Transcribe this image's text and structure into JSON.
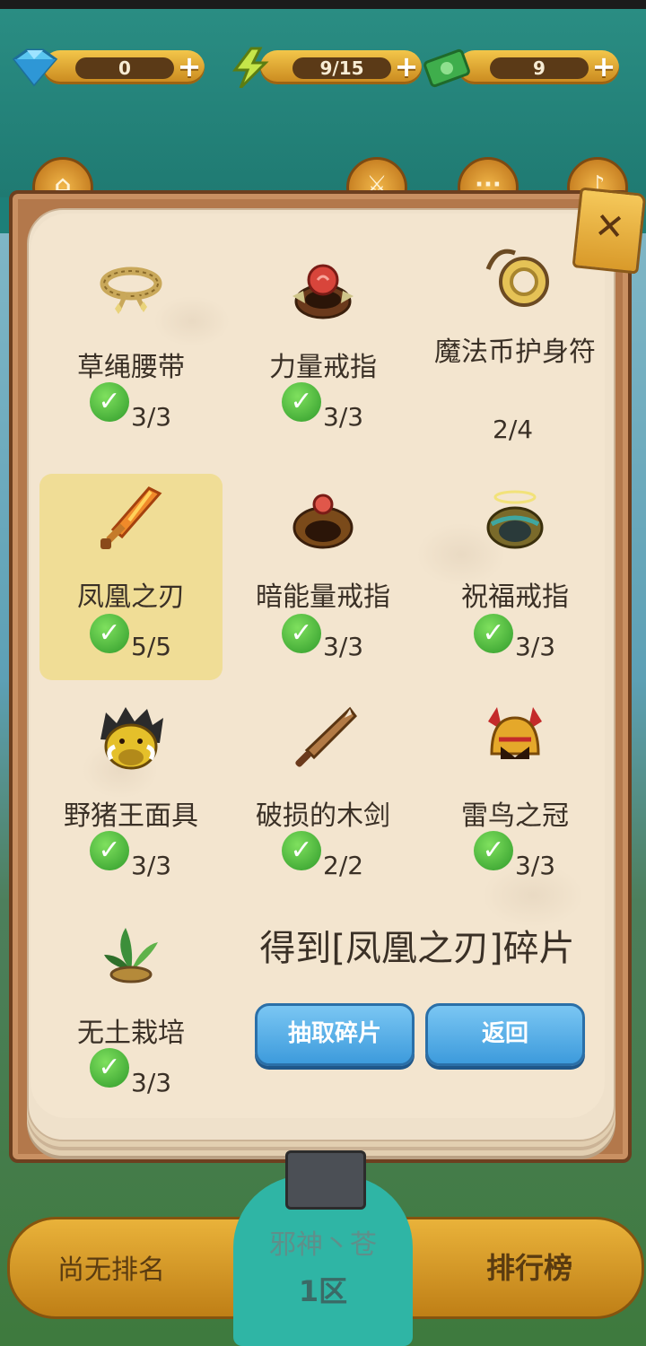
{
  "currencies": [
    {
      "icon": "diamond-icon",
      "value": "0"
    },
    {
      "icon": "energy-bolt-icon",
      "value": "9/15"
    },
    {
      "icon": "cash-icon",
      "value": "9"
    }
  ],
  "top_buttons": [
    "home-icon",
    "sword-icon",
    "more-icon",
    "sound-icon"
  ],
  "items": [
    {
      "name": "草绳腰带",
      "count": "3/3",
      "complete": true,
      "icon": "rope-belt-icon"
    },
    {
      "name": "力量戒指",
      "count": "3/3",
      "complete": true,
      "icon": "power-ring-icon"
    },
    {
      "name": "魔法币护身符",
      "count": "2/4",
      "complete": false,
      "icon": "magic-coin-amulet-icon"
    },
    {
      "name": "凤凰之刃",
      "count": "5/5",
      "complete": true,
      "icon": "phoenix-blade-icon",
      "selected": true
    },
    {
      "name": "暗能量戒指",
      "count": "3/3",
      "complete": true,
      "icon": "dark-energy-ring-icon"
    },
    {
      "name": "祝福戒指",
      "count": "3/3",
      "complete": true,
      "icon": "blessing-ring-icon"
    },
    {
      "name": "野猪王面具",
      "count": "3/3",
      "complete": true,
      "icon": "boar-king-mask-icon"
    },
    {
      "name": "破损的木剑",
      "count": "2/2",
      "complete": true,
      "icon": "broken-wooden-sword-icon"
    },
    {
      "name": "雷鸟之冠",
      "count": "3/3",
      "complete": true,
      "icon": "thunderbird-crown-icon"
    },
    {
      "name": "无土栽培",
      "count": "3/3",
      "complete": true,
      "icon": "soilless-plant-icon"
    }
  ],
  "obtain_text": "得到[凤凰之刃]碎片",
  "buttons": {
    "draw": "抽取碎片",
    "back": "返回"
  },
  "bottom": {
    "rank_left": "尚无排名",
    "player": "邪神丶苍",
    "zone": "1区",
    "leaderboard": "排行榜"
  },
  "colors": {
    "accent_gold": "#e9b23a",
    "button_blue": "#3d9bdc",
    "check_green": "#2f9a2a",
    "paper": "#f3e5cf"
  }
}
